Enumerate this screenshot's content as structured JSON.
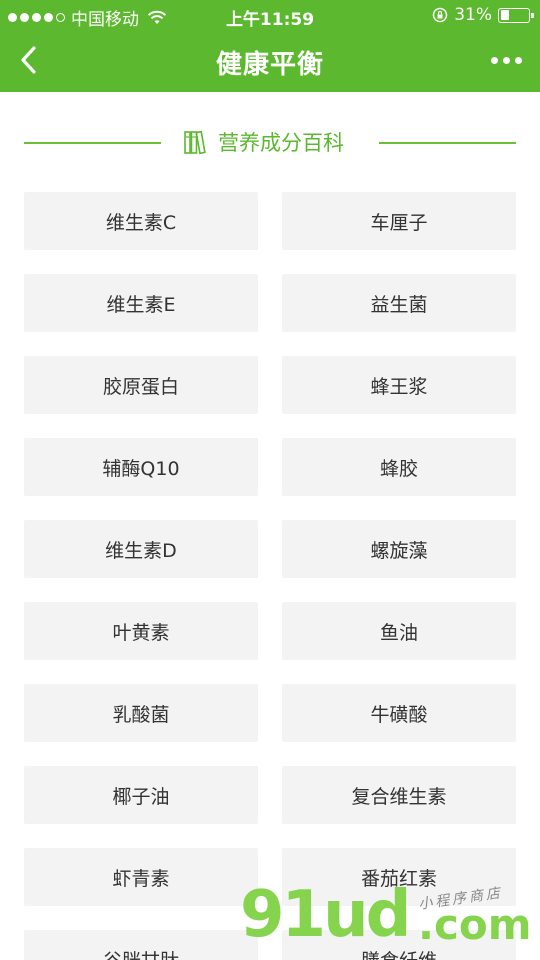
{
  "status_bar": {
    "carrier": "中国移动",
    "time": "上午11:59",
    "battery_text": "31%",
    "battery_level": 0.31
  },
  "nav": {
    "title": "健康平衡"
  },
  "section": {
    "title": "营养成分百科",
    "icon": "books-icon"
  },
  "items": [
    "维生素C",
    "车厘子",
    "维生素E",
    "益生菌",
    "胶原蛋白",
    "蜂王浆",
    "辅酶Q10",
    "蜂胶",
    "维生素D",
    "螺旋藻",
    "叶黄素",
    "鱼油",
    "乳酸菌",
    "牛磺酸",
    "椰子油",
    "复合维生素",
    "虾青素",
    "番茄红素",
    "谷胱甘肽",
    "膳食纤维"
  ],
  "watermark": {
    "main": "91ud",
    "com": ".com",
    "sub": "小程序商店"
  },
  "colors": {
    "brand": "#5cb82e",
    "card_bg": "#f3f3f3",
    "card_text": "#333333"
  }
}
